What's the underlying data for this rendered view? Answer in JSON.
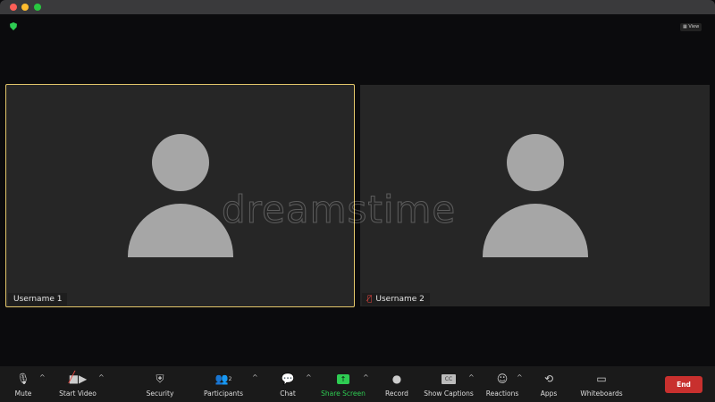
{
  "window": {
    "controls": [
      "close",
      "minimize",
      "maximize"
    ],
    "colors": {
      "close": "#fe5f57",
      "minimize": "#febc2e",
      "maximize": "#28c840"
    }
  },
  "header": {
    "view_label": "View"
  },
  "participants": [
    {
      "name": "Username 1",
      "active_speaker": true,
      "muted": false
    },
    {
      "name": "Username 2",
      "active_speaker": false,
      "muted": true
    }
  ],
  "watermark": "dreamstime",
  "toolbar": {
    "mute": "Mute",
    "start_video": "Start Video",
    "security": "Security",
    "participants": "Participants",
    "participant_count": "2",
    "chat": "Chat",
    "share_screen": "Share Screen",
    "record": "Record",
    "show_captions": "Show Captions",
    "cc": "CC",
    "reactions": "Reactions",
    "apps": "Apps",
    "whiteboards": "Whiteboards",
    "end": "End"
  },
  "colors": {
    "accent_green": "#2ecc52",
    "end_red": "#c8302e",
    "speaker_border": "#e3c66a"
  }
}
